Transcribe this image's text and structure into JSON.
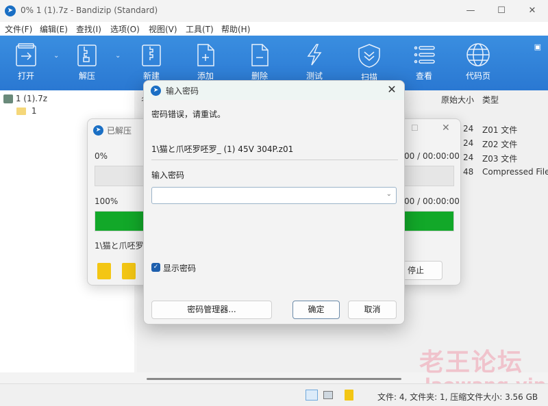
{
  "window": {
    "title": "0% 1 (1).7z - Bandizip (Standard)",
    "controls": {
      "minimize": "—",
      "maximize": "☐",
      "close": "✕"
    }
  },
  "menu": [
    "文件(F)",
    "编辑(E)",
    "查找(I)",
    "选项(O)",
    "视图(V)",
    "工具(T)",
    "帮助(H)"
  ],
  "toolbar": {
    "items": [
      {
        "label": "打开",
        "icon": "open-icon"
      },
      {
        "label": "解压",
        "icon": "extract-icon"
      },
      {
        "label": "新建",
        "icon": "new-archive-icon"
      },
      {
        "label": "添加",
        "icon": "add-file-icon"
      },
      {
        "label": "删除",
        "icon": "delete-file-icon"
      },
      {
        "label": "测试",
        "icon": "test-icon"
      },
      {
        "label": "扫描",
        "icon": "scan-shield-icon"
      },
      {
        "label": "查看",
        "icon": "view-list-icon"
      },
      {
        "label": "代码页",
        "icon": "globe-icon"
      }
    ],
    "layout_icon": "layout-grid-icon"
  },
  "tree": {
    "root": "1 (1).7z",
    "children": [
      "1"
    ]
  },
  "file_list": {
    "columns": [
      "名称",
      "原始大小",
      "类型"
    ],
    "rows": [
      {
        "size_partial": "24",
        "type": "Z01 文件"
      },
      {
        "size_partial": "24",
        "type": "Z02 文件"
      },
      {
        "size_partial": "24",
        "type": "Z03 文件"
      },
      {
        "size_partial": "48",
        "type": "Compressed File"
      }
    ]
  },
  "progress_dialog": {
    "title": "已解压",
    "current_label": "0%",
    "current_progress": 0,
    "current_time": "00 / 00:00:00",
    "total_label": "100%",
    "total_progress": 1.0,
    "total_time": "00 / 00:00:00",
    "file_partial": "1\\猫と爪呸罗",
    "stop_label": "停止"
  },
  "password_dialog": {
    "title": "输入密码",
    "error_message": "密码错误，请重试。",
    "file_name": "1\\猫と爪呸罗呸罗_ (1) 45V 304P.z01",
    "input_label": "输入密码",
    "input_value": "",
    "show_password_label": "显示密码",
    "show_password_checked": true,
    "password_manager_label": "密码管理器...",
    "ok_label": "确定",
    "cancel_label": "取消"
  },
  "statusbar": {
    "text": "文件: 4, 文件夹: 1, 压缩文件大小: 3.56 GB"
  },
  "watermark": {
    "line1": "老王论坛",
    "line2": "laowang.vip"
  }
}
